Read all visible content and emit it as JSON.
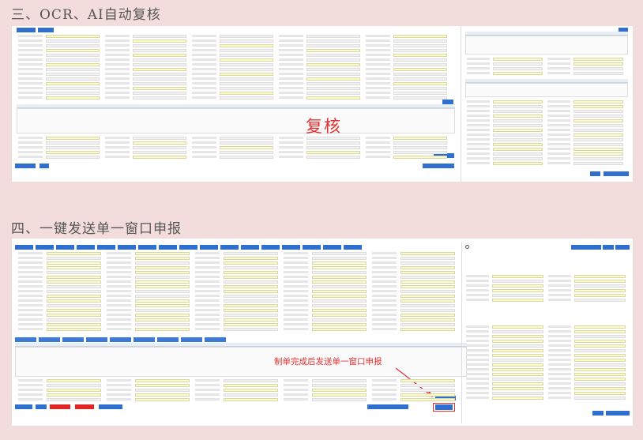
{
  "headings": {
    "section3": "三、OCR、AI自动复核",
    "section4": "四、一键发送单一窗口申报"
  },
  "shot1": {
    "stamp_text": "复核"
  },
  "shot2": {
    "annotation": "制单完成后发送单一窗口申报"
  },
  "colors": {
    "page_background": "#f3dcdc",
    "accent_blue": "#2f6fd0",
    "annotation_red": "#e53030",
    "field_yellow": "#fafad2"
  }
}
